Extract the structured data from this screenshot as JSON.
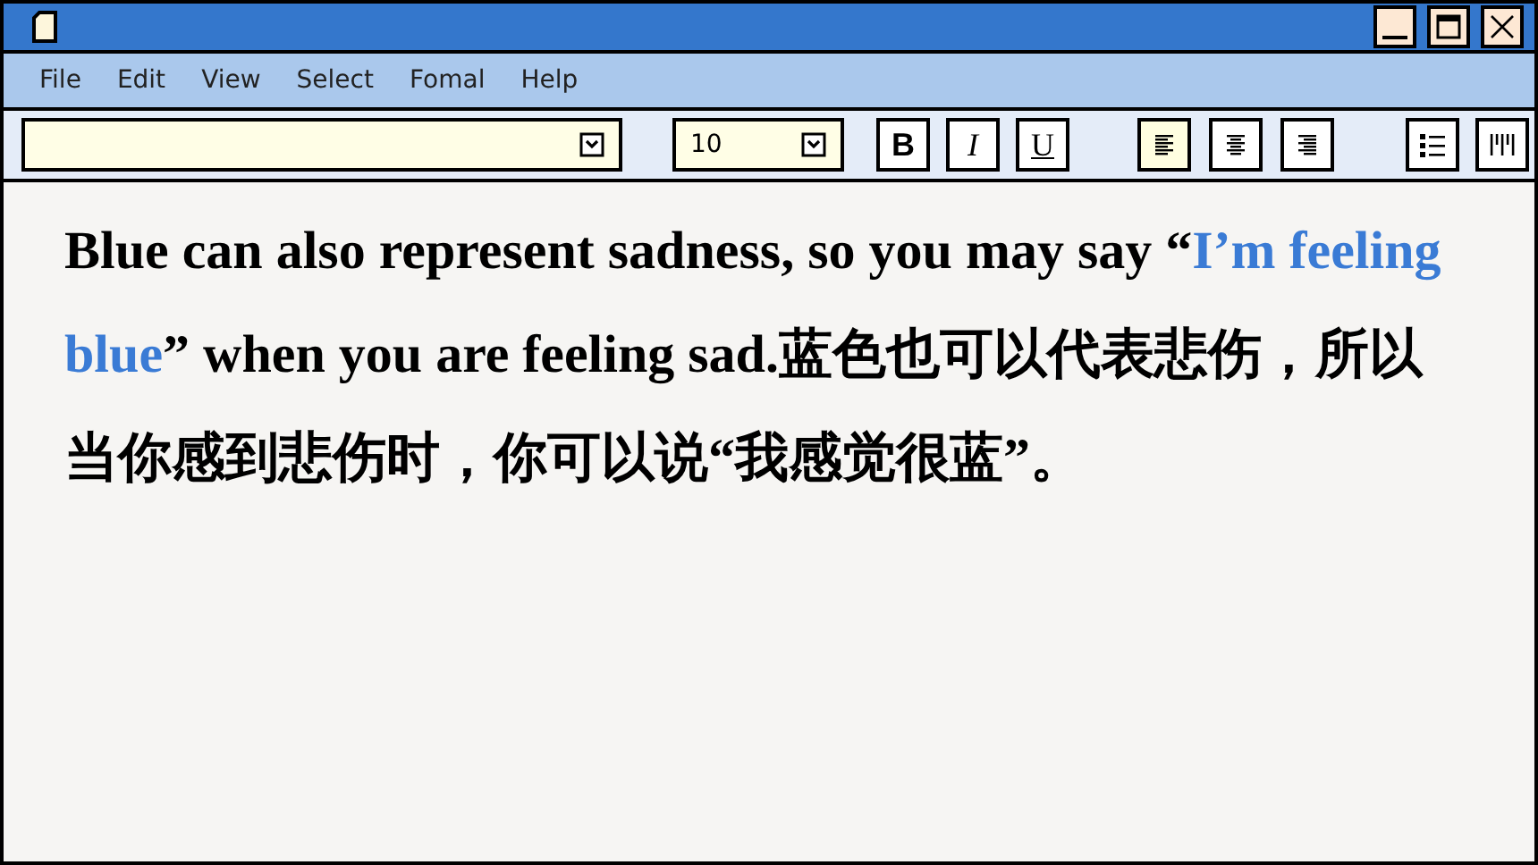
{
  "menu": [
    "File",
    "Edit",
    "View",
    "Select",
    "Fomal",
    "Help"
  ],
  "toolbar": {
    "size_field": {
      "value": "10"
    },
    "format_buttons": [
      {
        "label": "B",
        "kind": "bold"
      },
      {
        "label": "I",
        "kind": "italic"
      },
      {
        "label": "U",
        "kind": "underline"
      }
    ],
    "align_buttons": [
      {
        "kind": "left",
        "selected": true
      },
      {
        "kind": "center",
        "selected": false
      },
      {
        "kind": "right",
        "selected": false
      }
    ],
    "list_buttons": [
      {
        "kind": "bullets"
      },
      {
        "kind": "columns"
      }
    ]
  },
  "document": {
    "segments": [
      {
        "text": "Blue can also represent sadness, so you may say “",
        "highlighted": false
      },
      {
        "text": "I’m feeling blue",
        "highlighted": true
      },
      {
        "text": "” when you are feeling sad.蓝色也可以代表悲伤，所以当你感到悲伤时，你可以说“我感觉很蓝”。",
        "highlighted": false
      }
    ]
  }
}
